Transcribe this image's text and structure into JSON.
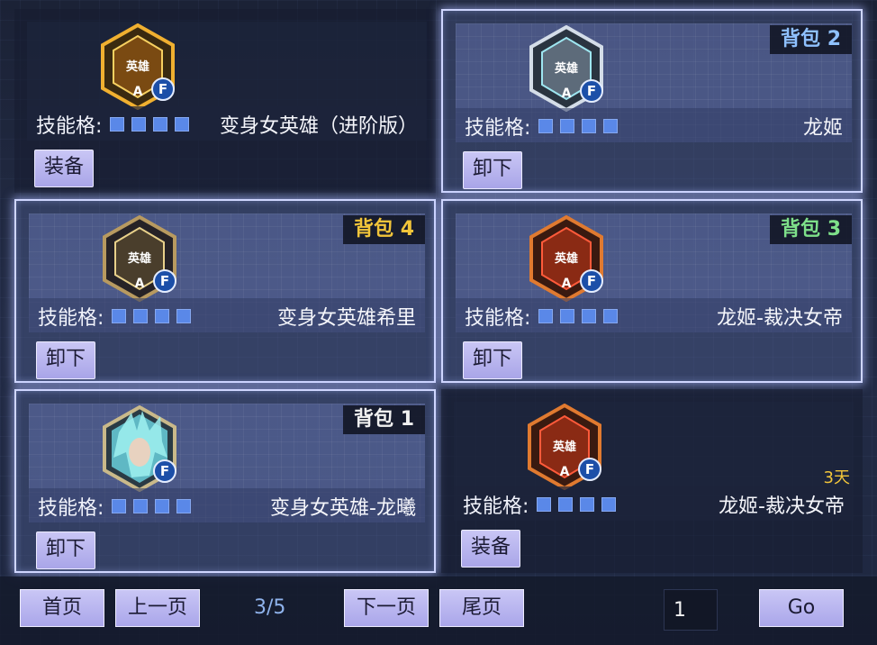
{
  "cards": [
    {
      "hero_name": "变身女英雄（进阶版）",
      "skill_label": "技能格:",
      "button": "装备",
      "badge": "",
      "days": "",
      "emblem": {
        "icon": "hero-emblem-gold",
        "color": "#e0a020",
        "text": "英雄",
        "grade": "A",
        "tier": "F"
      }
    },
    {
      "hero_name": "龙姬",
      "skill_label": "技能格:",
      "button": "卸下",
      "badge": "背包 2",
      "badge_color": "#8fc1ff",
      "days": "",
      "emblem": {
        "icon": "hero-emblem-silver",
        "color": "#c9d4e0",
        "text": "英雄",
        "grade": "A",
        "tier": "F"
      }
    },
    {
      "hero_name": "变身女英雄希里",
      "skill_label": "技能格:",
      "button": "卸下",
      "badge": "背包 4",
      "badge_color": "#f2c53a",
      "days": "",
      "emblem": {
        "icon": "hero-emblem-dark-gold",
        "color": "#cdb075",
        "text": "英雄",
        "grade": "A",
        "tier": "F"
      }
    },
    {
      "hero_name": "龙姬-裁决女帝",
      "skill_label": "技能格:",
      "button": "卸下",
      "badge": "背包 3",
      "badge_color": "#7ee08a",
      "days": "",
      "emblem": {
        "icon": "hero-emblem-red",
        "color": "#e06a2a",
        "text": "英雄",
        "grade": "A",
        "tier": "F"
      }
    },
    {
      "hero_name": "变身女英雄-龙曦",
      "skill_label": "技能格:",
      "button": "卸下",
      "badge": "背包 1",
      "badge_color": "#f0f0f0",
      "days": "",
      "emblem": {
        "icon": "hero-portrait-longxi",
        "color": "#6fd8e0",
        "text": "",
        "grade": "",
        "tier": "F"
      }
    },
    {
      "hero_name": "龙姬-裁决女帝",
      "skill_label": "技能格:",
      "button": "装备",
      "badge": "",
      "days": "3天",
      "emblem": {
        "icon": "hero-emblem-red",
        "color": "#e06a2a",
        "text": "英雄",
        "grade": "A",
        "tier": "F"
      }
    }
  ],
  "pagination": {
    "first": "首页",
    "prev": "上一页",
    "indicator": "3/5",
    "next": "下一页",
    "last": "尾页",
    "input_value": "1",
    "go": "Go"
  }
}
